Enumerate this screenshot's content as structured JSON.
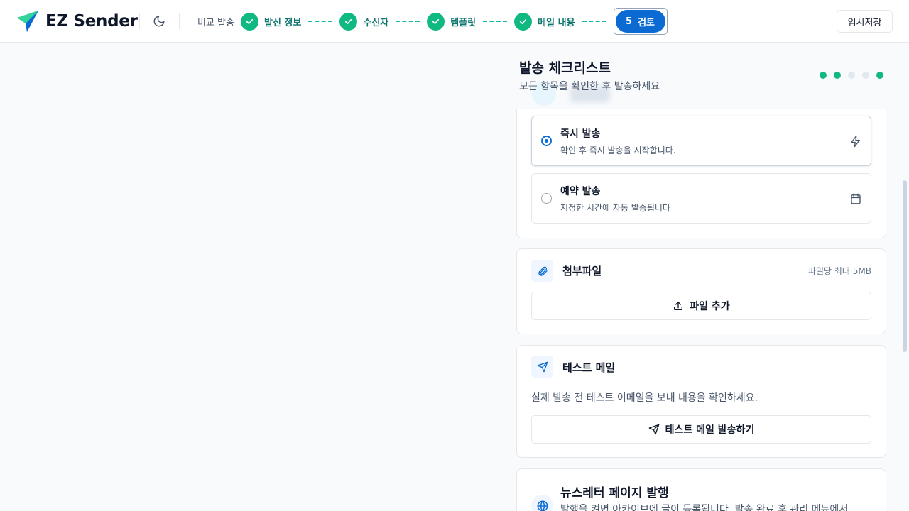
{
  "app": {
    "name": "EZ Sender"
  },
  "header": {
    "theme_icon": "moon-icon",
    "stepper": {
      "compare_label": "비교 발송",
      "steps": [
        {
          "label": "발신 정보",
          "status": "done"
        },
        {
          "label": "수신자",
          "status": "done"
        },
        {
          "label": "템플릿",
          "status": "done"
        },
        {
          "label": "메일 내용",
          "status": "done"
        }
      ],
      "current": {
        "number": "5",
        "label": "검토"
      }
    },
    "save_label": "임시저장"
  },
  "checklist": {
    "title": "발송 체크리스트",
    "subtitle": "모든 항목을 확인한 후 발송하세요",
    "progress_dots": [
      "done",
      "done",
      "pending",
      "pending",
      "done"
    ]
  },
  "send_mode": {
    "options": [
      {
        "title": "즉시 발송",
        "desc": "확인 후 즉시 발송을 시작합니다.",
        "selected": true,
        "icon": "lightning-icon"
      },
      {
        "title": "예약 발송",
        "desc": "지정한 시간에 자동 발송됩니다",
        "selected": false,
        "icon": "calendar-icon"
      }
    ]
  },
  "attachment": {
    "title": "첨부파일",
    "note": "파일당 최대 5MB",
    "button_label": "파일 추가"
  },
  "test_mail": {
    "title": "테스트 메일",
    "desc": "실제 발송 전 테스트 이메일을 보내 내용을 확인하세요.",
    "button_label": "테스트 메일 발송하기"
  },
  "newsletter": {
    "title": "뉴스레터 페이지 발행",
    "desc": "발행을 켜면 아카이브에 글이 등록됩니다. 발송 완료 후 관리 메뉴에서"
  },
  "colors": {
    "accent": "#0b6bd3",
    "success": "#10b981",
    "step_text": "#0f766e",
    "dot_pending": "#e2e8f0"
  }
}
